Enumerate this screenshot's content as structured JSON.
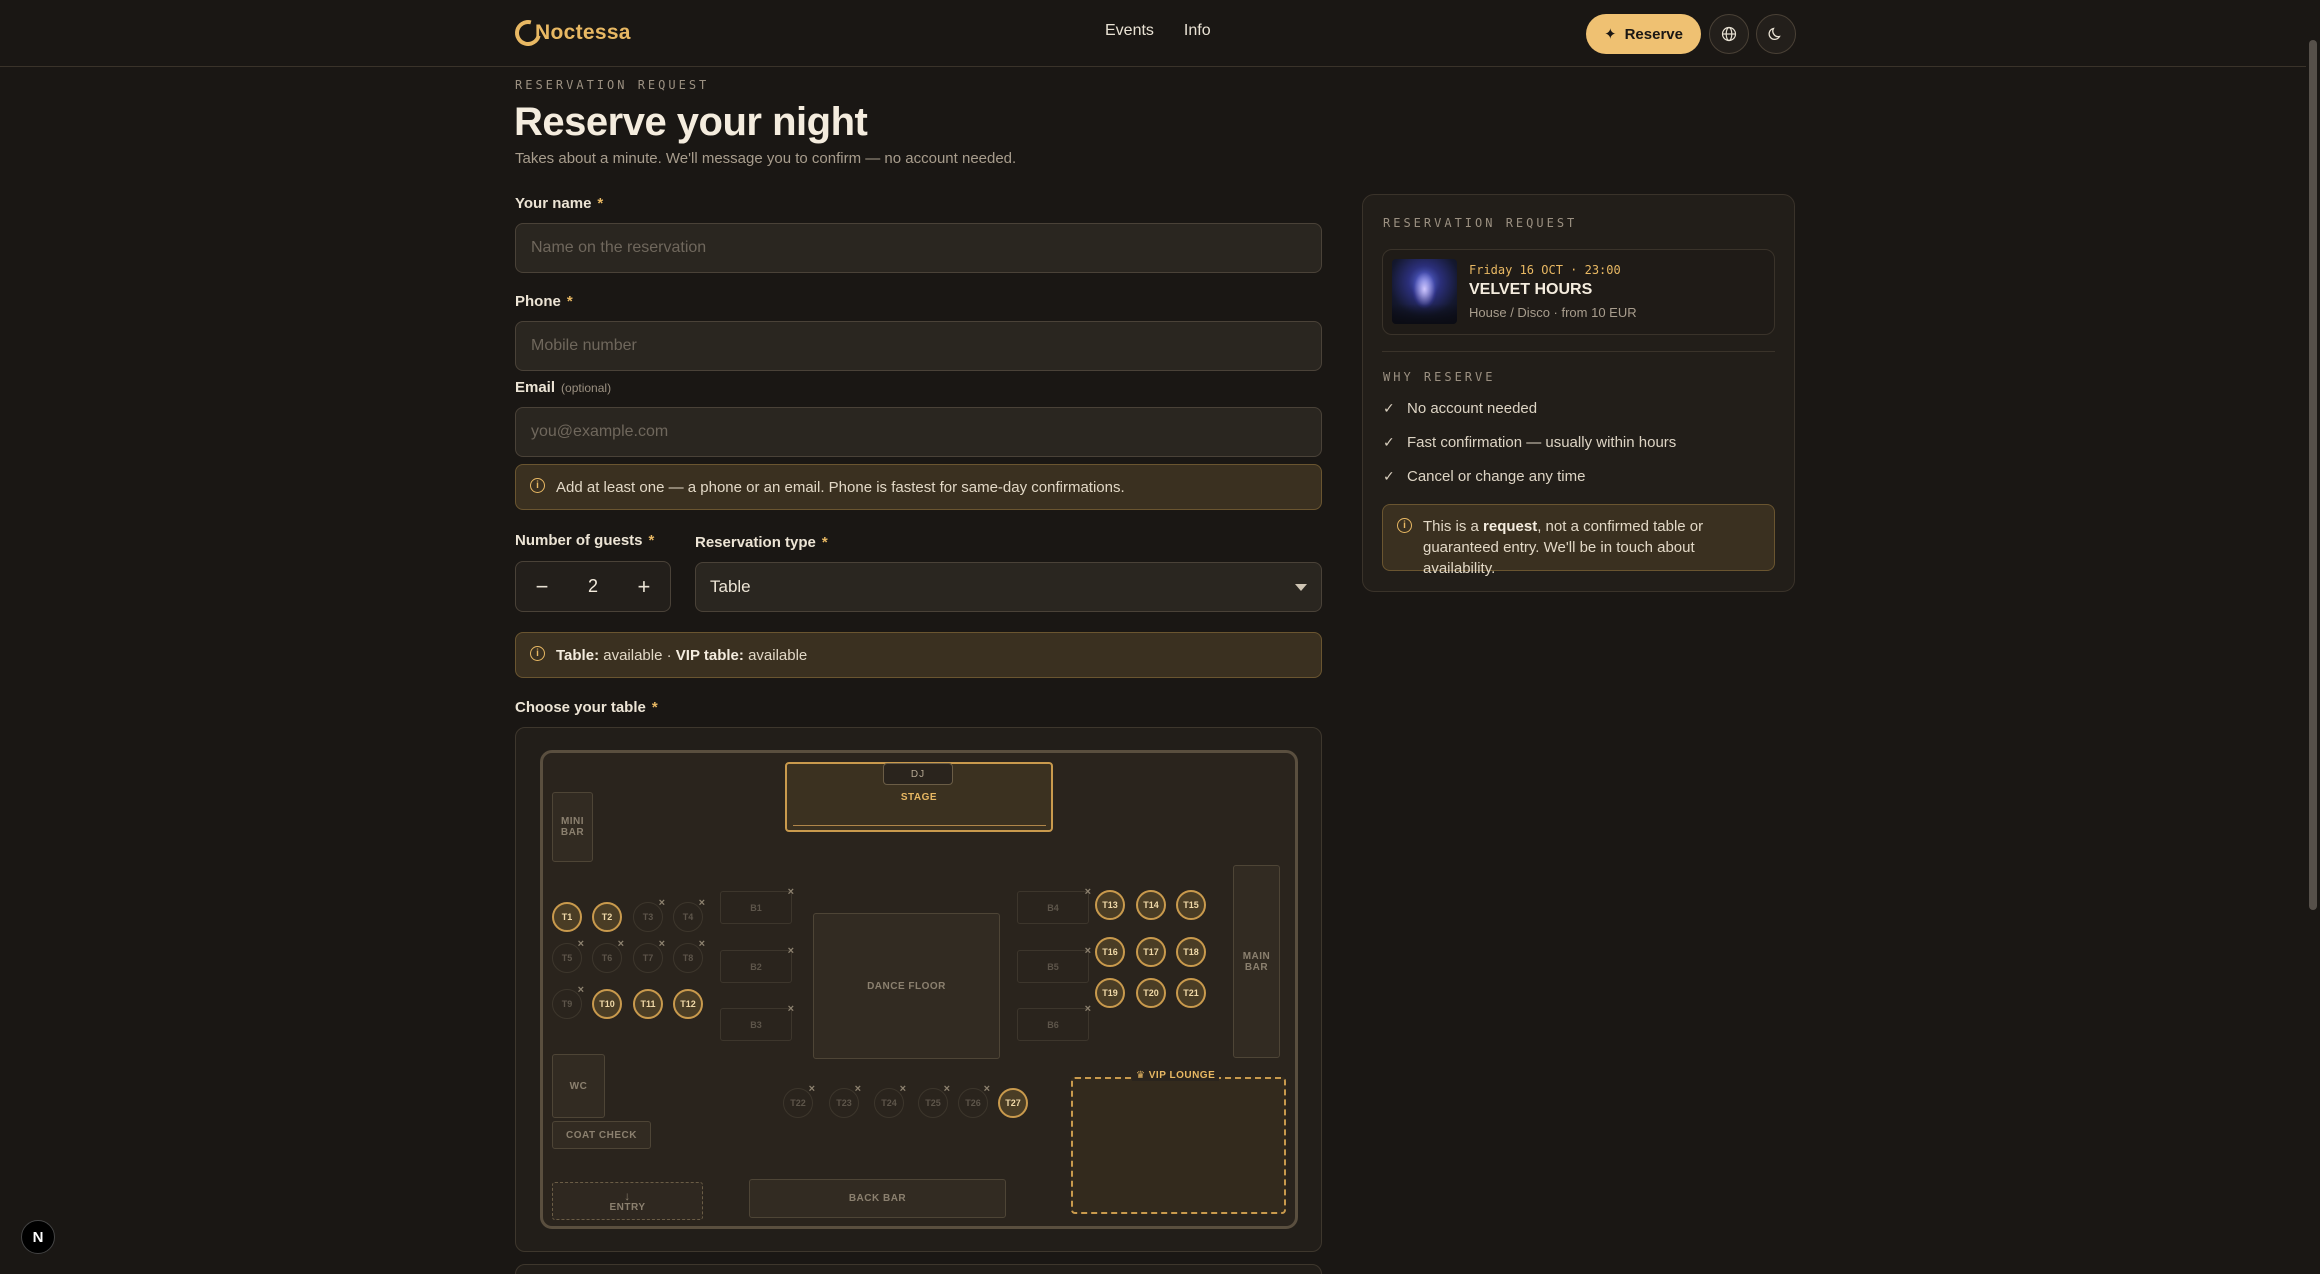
{
  "header": {
    "brand": "Noctessa",
    "nav": [
      "Events",
      "Info"
    ],
    "reserve_label": "Reserve",
    "reserve_icon": "sparkle-icon",
    "language_icon": "globe-icon",
    "theme_icon": "moon-icon"
  },
  "page": {
    "kicker": "RESERVATION REQUEST",
    "title": "Reserve your night",
    "subtitle": "Takes about a minute. We'll message you to confirm — no account needed."
  },
  "form": {
    "name": {
      "label": "Your name",
      "required": "*",
      "placeholder": "Name on the reservation",
      "value": ""
    },
    "phone": {
      "label": "Phone",
      "required": "*",
      "placeholder": "Mobile number",
      "value": ""
    },
    "email": {
      "label": "Email",
      "optional": "(optional)",
      "placeholder": "you@example.com",
      "value": ""
    },
    "contact_note": "Add at least one — a phone or an email. Phone is fastest for same-day confirmations.",
    "guests": {
      "label": "Number of guests",
      "required": "*",
      "value": "2",
      "minus": "−",
      "plus": "+"
    },
    "type": {
      "label": "Reservation type",
      "required": "*",
      "value": "Table"
    },
    "availability": {
      "table_label": "Table:",
      "table_status": "available",
      "separator": "·",
      "vip_label": "VIP table:",
      "vip_status": "available"
    },
    "choose_label": "Choose your table",
    "choose_required": "*"
  },
  "floor_plan": {
    "dj": "DJ",
    "stage": "STAGE",
    "mini_bar": "MINI BAR",
    "main_bar": "MAIN BAR",
    "dance_floor": "DANCE FLOOR",
    "wc": "WC",
    "coat_check": "COAT CHECK",
    "entry": "ENTRY",
    "entry_icon": "arrow-down-icon",
    "back_bar": "BACK BAR",
    "vip_lounge": "♛ VIP LOUNGE",
    "tables": [
      {
        "id": "T1",
        "available": true
      },
      {
        "id": "T2",
        "available": true
      },
      {
        "id": "T3",
        "available": false
      },
      {
        "id": "T4",
        "available": false
      },
      {
        "id": "T5",
        "available": false
      },
      {
        "id": "T6",
        "available": false
      },
      {
        "id": "T7",
        "available": false
      },
      {
        "id": "T8",
        "available": false
      },
      {
        "id": "T9",
        "available": false
      },
      {
        "id": "T10",
        "available": true
      },
      {
        "id": "T11",
        "available": true
      },
      {
        "id": "T12",
        "available": true
      },
      {
        "id": "T13",
        "available": true
      },
      {
        "id": "T14",
        "available": true
      },
      {
        "id": "T15",
        "available": true
      },
      {
        "id": "T16",
        "available": true
      },
      {
        "id": "T17",
        "available": true
      },
      {
        "id": "T18",
        "available": true
      },
      {
        "id": "T19",
        "available": true
      },
      {
        "id": "T20",
        "available": true
      },
      {
        "id": "T21",
        "available": true
      },
      {
        "id": "T22",
        "available": false
      },
      {
        "id": "T23",
        "available": false
      },
      {
        "id": "T24",
        "available": false
      },
      {
        "id": "T25",
        "available": false
      },
      {
        "id": "T26",
        "available": false
      },
      {
        "id": "T27",
        "available": true
      }
    ],
    "booths": [
      {
        "id": "B1",
        "available": false
      },
      {
        "id": "B2",
        "available": false
      },
      {
        "id": "B3",
        "available": false
      },
      {
        "id": "B4",
        "available": false
      },
      {
        "id": "B5",
        "available": false
      },
      {
        "id": "B6",
        "available": false
      }
    ]
  },
  "summary": {
    "kicker": "RESERVATION REQUEST",
    "event": {
      "date": "Friday 16 OCT · 23:00",
      "name": "VELVET HOURS",
      "meta": "House / Disco · from 10 EUR"
    },
    "why_kicker": "WHY RESERVE",
    "reasons": [
      "No account needed",
      "Fast confirmation — usually within hours",
      "Cancel or change any time"
    ],
    "note_pre": "This is a",
    "note_bold": "request",
    "note_post": ", not a confirmed table or guaranteed entry. We'll be in touch about availability."
  },
  "colors": {
    "accent": "#efc172",
    "background": "#1a1714",
    "card": "#221e19"
  },
  "badge": "N"
}
